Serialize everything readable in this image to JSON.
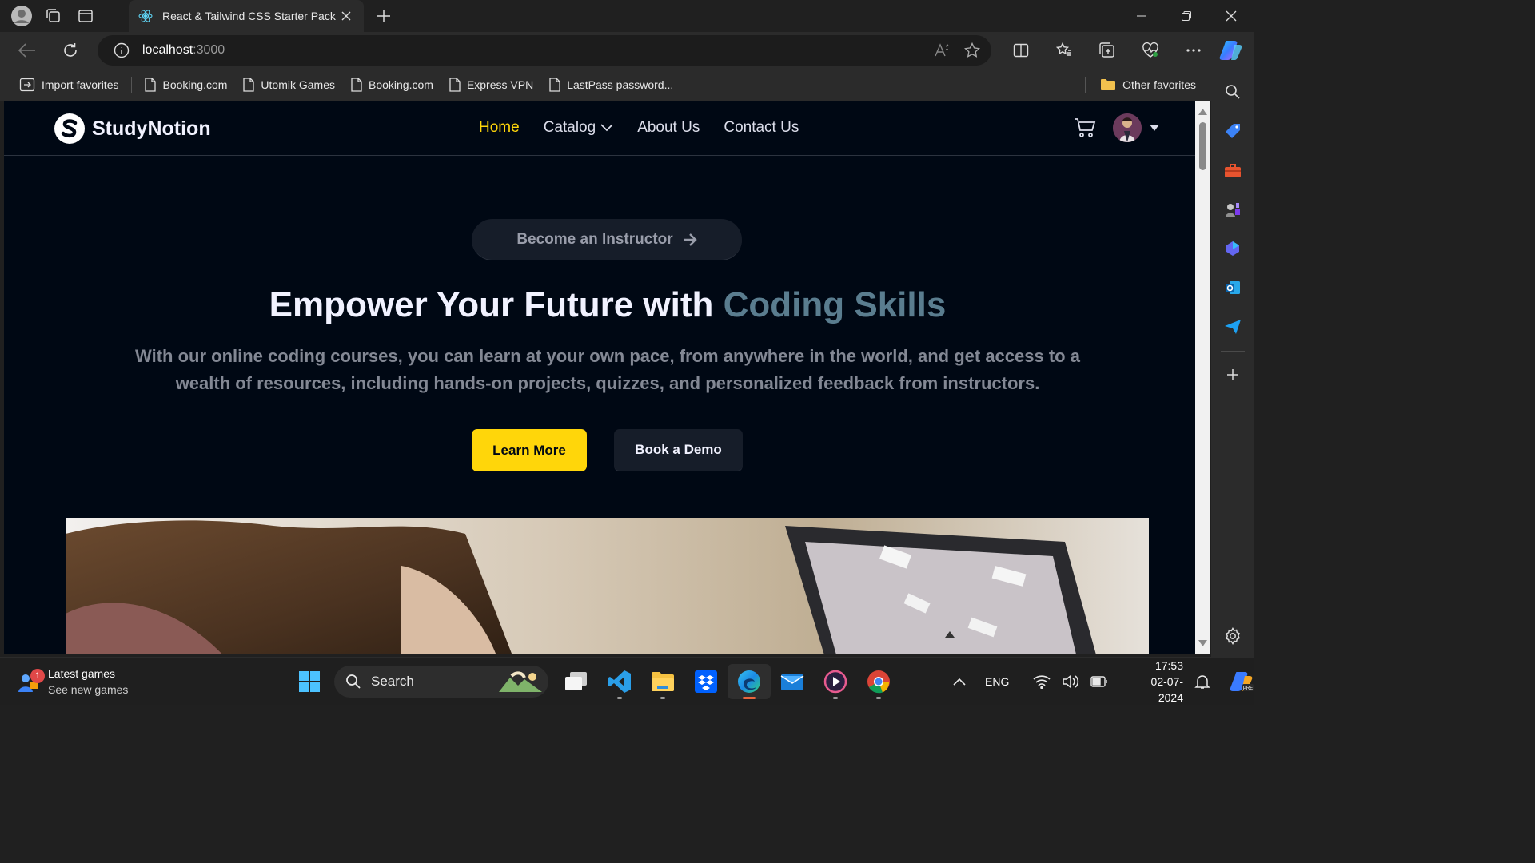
{
  "browser": {
    "tab_title": "React & Tailwind CSS Starter Pack",
    "address_host": "localhost",
    "address_port": ":3000",
    "favorites": [
      {
        "label": "Import favorites",
        "icon": "import-icon"
      },
      {
        "label": "Booking.com",
        "icon": "page-icon"
      },
      {
        "label": "Utomik Games",
        "icon": "page-icon"
      },
      {
        "label": "Booking.com",
        "icon": "page-icon"
      },
      {
        "label": "Express VPN",
        "icon": "page-icon"
      },
      {
        "label": "LastPass password...",
        "icon": "page-icon"
      }
    ],
    "other_favorites": "Other favorites"
  },
  "site": {
    "brand": "StudyNotion",
    "nav": [
      {
        "label": "Home",
        "active": true
      },
      {
        "label": "Catalog",
        "dropdown": true
      },
      {
        "label": "About Us"
      },
      {
        "label": "Contact Us"
      }
    ],
    "instructor_button": "Become an Instructor",
    "hero_title_plain": "Empower Your Future with ",
    "hero_title_highlight": "Coding Skills",
    "hero_subtitle": "With our online coding courses, you can learn at your own pace, from anywhere in the world, and get access to a wealth of resources, including hands-on projects, quizzes, and personalized feedback from instructors.",
    "cta_primary": "Learn More",
    "cta_secondary": "Book a Demo"
  },
  "taskbar": {
    "widget_title": "Latest games",
    "widget_subtitle": "See new games",
    "widget_badge": "1",
    "search_label": "Search",
    "language": "ENG",
    "time": "17:53",
    "date": "02-07-2024"
  },
  "colors": {
    "accent_yellow": "#ffd60a",
    "page_bg": "#000814",
    "highlight": "#5a7d8f"
  }
}
